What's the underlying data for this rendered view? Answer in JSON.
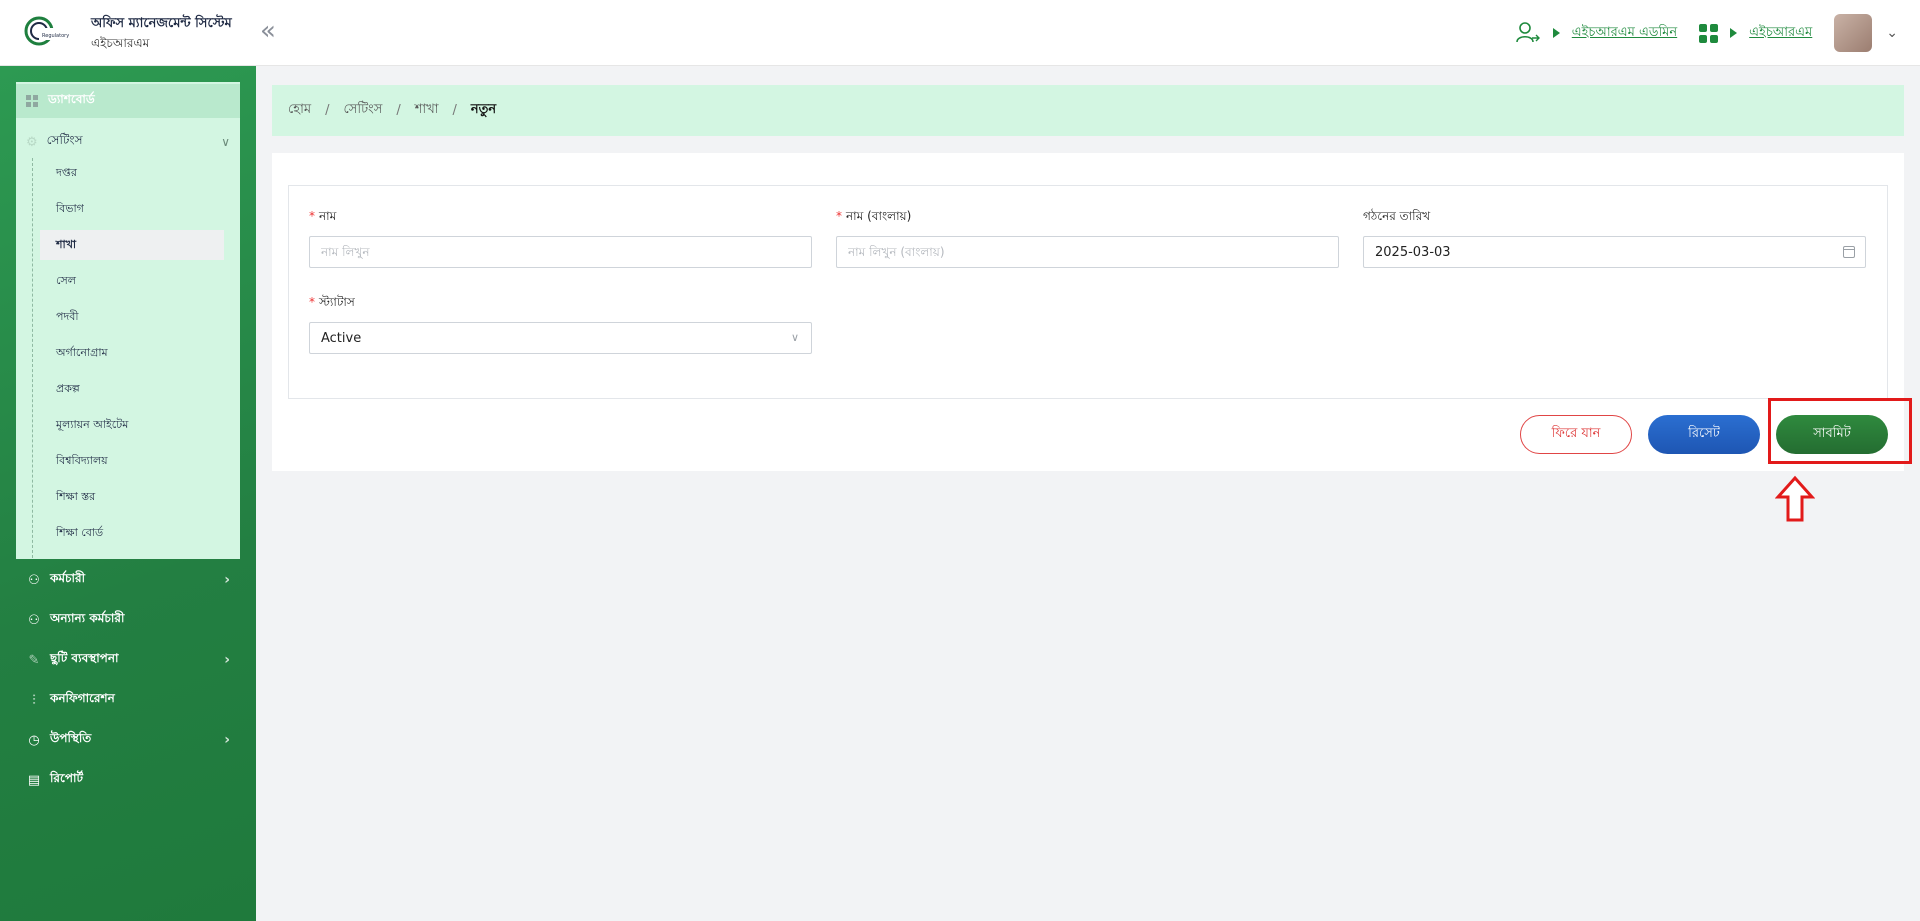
{
  "header": {
    "title": "অফিস ম্যানেজমেন্ট সিস্টেম",
    "subtitle": "এইচআরএম",
    "role_link": "এইচআরএম এডমিন",
    "module_link": "এইচআরএম",
    "collapse_icon": "«"
  },
  "sidebar": {
    "dashboard": "ড্যাশবোর্ড",
    "settings": "সেটিংস",
    "settings_items": [
      "দপ্তর",
      "বিভাগ",
      "শাখা",
      "সেল",
      "পদবী",
      "অর্গানোগ্রাম",
      "প্রকল্প",
      "মূল্যায়ন আইটেম",
      "বিশ্ববিদ্যালয়",
      "শিক্ষা স্তর",
      "শিক্ষা বোর্ড"
    ],
    "active_item": "শাখা",
    "nav": [
      {
        "label": "কর্মচারী",
        "has_arrow": true
      },
      {
        "label": "অন্যান্য কর্মচারী",
        "has_arrow": false
      },
      {
        "label": "ছুটি ব্যবস্থাপনা",
        "has_arrow": true
      },
      {
        "label": "কনফিগারেশন",
        "has_arrow": false
      },
      {
        "label": "উপস্থিতি",
        "has_arrow": true
      },
      {
        "label": "রিপোর্ট",
        "has_arrow": false
      }
    ]
  },
  "breadcrumb": {
    "items": [
      "হোম",
      "সেটিংস",
      "শাখা"
    ],
    "current": "নতুন",
    "separator": "/"
  },
  "form": {
    "name_label": "নাম",
    "name_placeholder": "নাম লিখুন",
    "name_bn_label": "নাম (বাংলায়)",
    "name_bn_placeholder": "নাম লিখুন (বাংলায়)",
    "date_label": "গঠনের তারিখ",
    "date_value": "2025-03-03",
    "status_label": "স্ট্যাটাস",
    "status_value": "Active",
    "required_mark": "*"
  },
  "buttons": {
    "back": "ফিরে যান",
    "reset": "রিসেট",
    "submit": "সাবমিট"
  },
  "colors": {
    "brand_green": "#1e8a3d",
    "highlight_red": "#e21a1a",
    "reset_blue": "#1e56b3"
  }
}
